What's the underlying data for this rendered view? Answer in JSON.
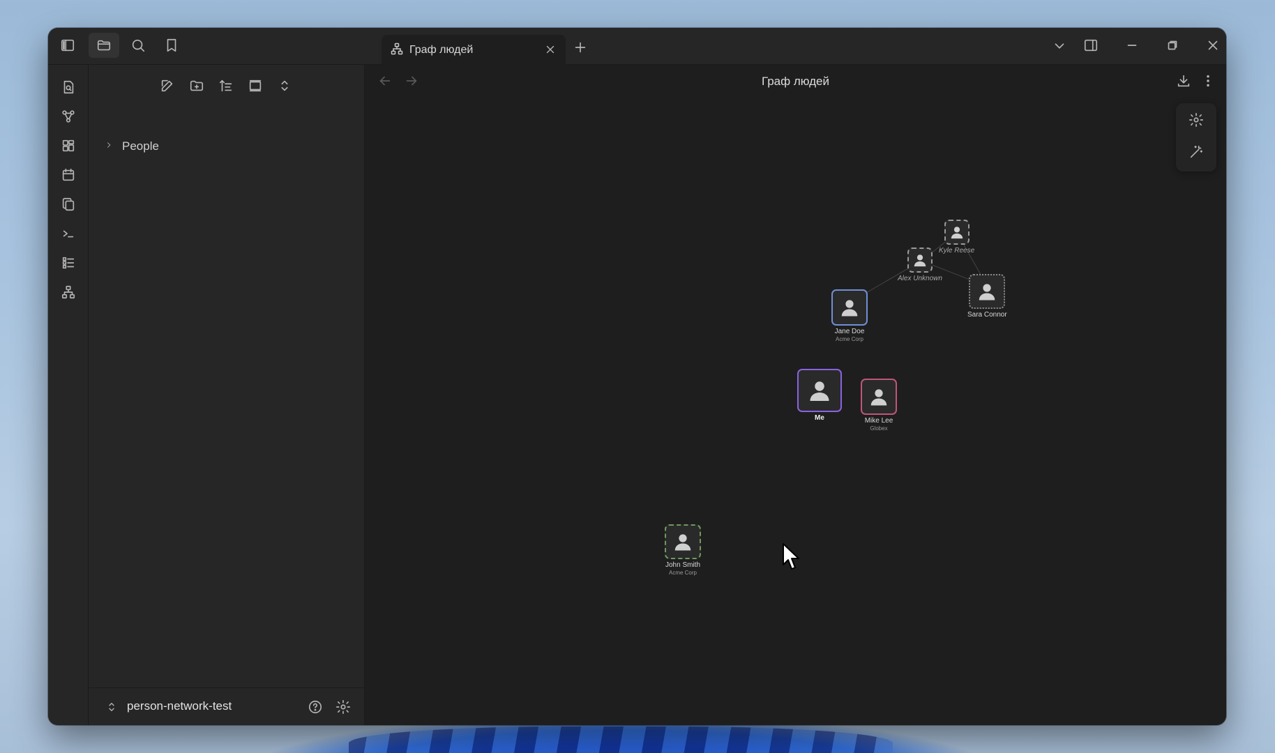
{
  "window": {
    "tab_label": "Граф людей",
    "view_title": "Граф людей"
  },
  "titlebar": {
    "left_icons": [
      "sidebar-toggle-icon",
      "folder-icon",
      "search-icon",
      "bookmark-icon"
    ],
    "right_icons": [
      "chevron-down-icon",
      "right-sidebar-icon",
      "minimize-icon",
      "restore-icon",
      "close-icon"
    ]
  },
  "ribbon": {
    "icons": [
      "file-search-icon",
      "graph-icon",
      "canvas-icon",
      "calendar-icon",
      "copy-icon",
      "terminal-icon",
      "list-icon",
      "network-icon"
    ]
  },
  "sidebar": {
    "toolbar_icons": [
      "new-note-icon",
      "new-folder-icon",
      "sort-icon",
      "collapse-icon",
      "expand-icon"
    ],
    "tree": [
      {
        "label": "People"
      }
    ],
    "vault_name": "person-network-test"
  },
  "graph": {
    "nodes": [
      {
        "id": "kyle",
        "name": "Kyle Reese",
        "org": "",
        "style": "dashed",
        "border": "#9a9a9a"
      },
      {
        "id": "alex",
        "name": "Alex Unknown",
        "org": "",
        "style": "dashed",
        "border": "#9a9a9a"
      },
      {
        "id": "sara",
        "name": "Sara Connor",
        "org": "",
        "style": "dotted",
        "border": "#8a8a8a"
      },
      {
        "id": "jane",
        "name": "Jane Doe",
        "org": "Acme Corp",
        "style": "solid",
        "border": "#6f8fd6"
      },
      {
        "id": "me",
        "name": "Me",
        "org": "",
        "style": "solid",
        "border": "#8a63e0"
      },
      {
        "id": "mike",
        "name": "Mike Lee",
        "org": "Globex",
        "style": "solid",
        "border": "#c0557a"
      },
      {
        "id": "john",
        "name": "John Smith",
        "org": "Acme Corp",
        "style": "dashed",
        "border": "#6f9a5f"
      }
    ],
    "edges": [
      [
        "kyle",
        "alex"
      ],
      [
        "kyle",
        "sara"
      ],
      [
        "alex",
        "sara"
      ],
      [
        "alex",
        "jane"
      ]
    ]
  },
  "colors": {
    "background": "#1e1e1e",
    "panel": "#262626",
    "accent": "#8a63e0"
  }
}
